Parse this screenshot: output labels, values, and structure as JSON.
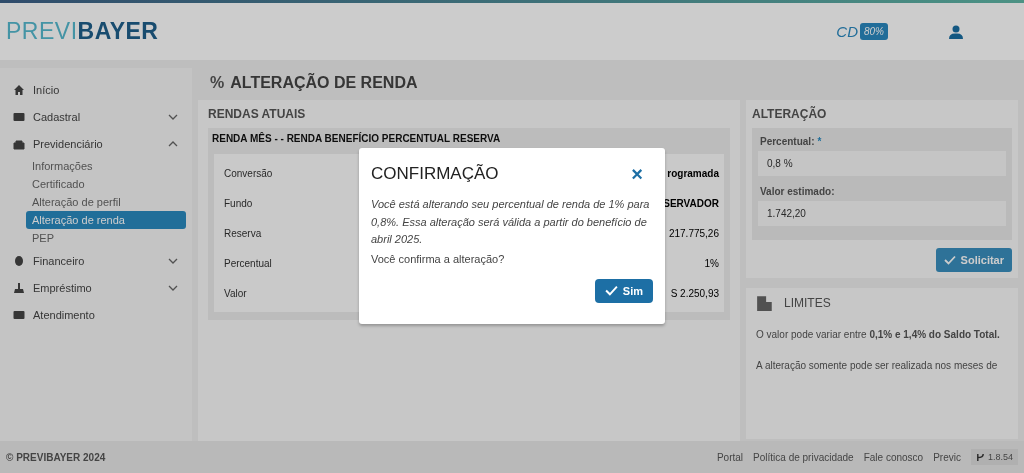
{
  "header": {
    "logo_light": "PREVI",
    "logo_bold": "BAYER",
    "plan_badge": {
      "prefix": "CD",
      "value": "80%"
    }
  },
  "sidebar": {
    "items": [
      {
        "label": "Início",
        "selected": false
      },
      {
        "label": "Cadastral",
        "selected": false,
        "expanded": false
      },
      {
        "label": "Previdenciário",
        "selected": false,
        "expanded": true,
        "children": [
          {
            "label": "Informações",
            "selected": false
          },
          {
            "label": "Certificado",
            "selected": false
          },
          {
            "label": "Alteração de perfil",
            "selected": false
          },
          {
            "label": "Alteração de renda",
            "selected": true
          },
          {
            "label": "PEP",
            "selected": false
          }
        ]
      },
      {
        "label": "Financeiro",
        "selected": false,
        "expanded": false
      },
      {
        "label": "Empréstimo",
        "selected": false,
        "expanded": false
      },
      {
        "label": "Atendimento",
        "selected": false
      }
    ]
  },
  "page_title": {
    "symbol": "%",
    "text": "ALTERAÇÃO DE RENDA"
  },
  "rendas": {
    "title": "RENDAS ATUAIS",
    "card_title": "RENDA MÊS - - RENDA BENEFÍCIO PERCENTUAL RESERVA",
    "rows": [
      {
        "label": "Conversão",
        "value": "rogramada"
      },
      {
        "label": "Fundo",
        "value": "SERVADOR"
      },
      {
        "label": "Reserva",
        "value": "217.775,26"
      },
      {
        "label": "Percentual",
        "value": "1%"
      },
      {
        "label": "Valor",
        "value": "S 2.250,93"
      }
    ]
  },
  "alteracao": {
    "title": "ALTERAÇÃO",
    "fields": [
      {
        "label": "Percentual:",
        "required_mark": "*",
        "value": "0,8 %"
      },
      {
        "label": "Valor estimado:",
        "value": "1.742,20"
      }
    ],
    "button": "Solicitar"
  },
  "limites": {
    "title": "LIMITES",
    "paragraphs": [
      "O valor pode variar entre **0,1% e 1,4% do Saldo Total.**",
      "A alteração somente pode ser realizada nos meses de"
    ]
  },
  "footer": {
    "copyright": "© PREVIBAYER 2024",
    "links": [
      "Portal",
      "Política de privacidade",
      "Fale conosco",
      "Previc"
    ],
    "version": "1.8.54"
  },
  "dialog": {
    "title": "CONFIRMAÇÃO",
    "close": "×",
    "message": "Você está alterando seu percentual de renda de 1% para 0,8%. Essa alteração será válida a partir do benefício de abril 2025.",
    "question": "Você confirma a alteração?",
    "confirm": "Sim"
  }
}
